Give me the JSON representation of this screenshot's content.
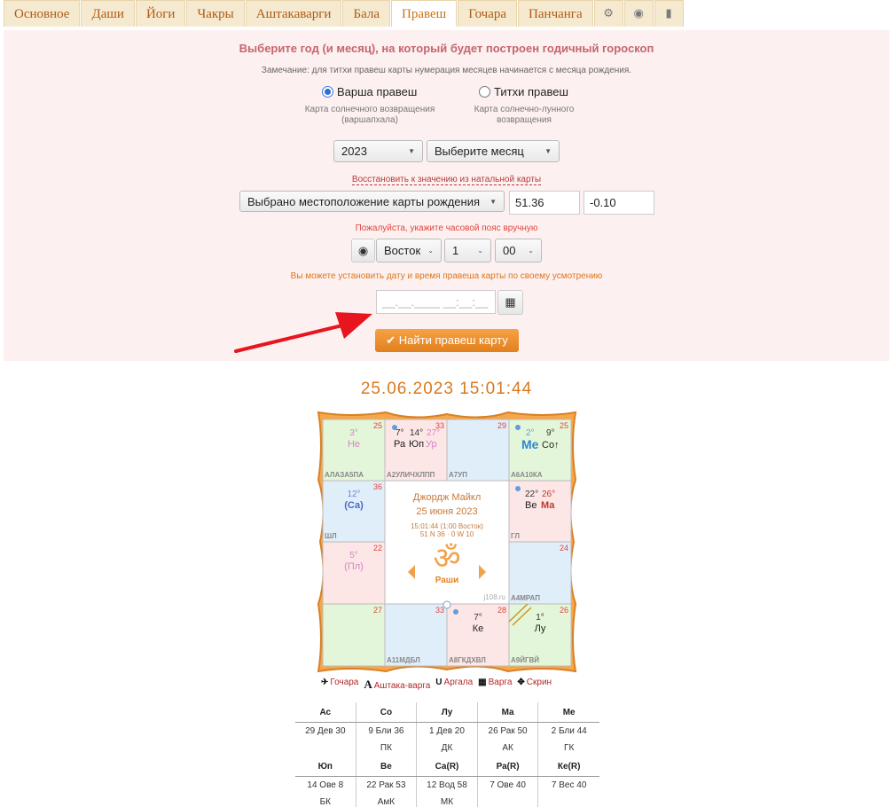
{
  "tabs": [
    "Основное",
    "Даши",
    "Йоги",
    "Чакры",
    "Аштакаварги",
    "Бала",
    "Правеш",
    "Гочара",
    "Панчанга"
  ],
  "active_tab": "Правеш",
  "icon_tabs": [
    "gear-icon",
    "globe-icon",
    "book-icon"
  ],
  "form": {
    "title": "Выберите год (и месяц), на который будет построен годичный гороскоп",
    "note": "Замечание: для титхи правеш карты нумерация месяцев начинается с месяца рождения.",
    "radio1_label": "Варша правеш",
    "radio1_sub1": "Карта солнечного возвращения",
    "radio1_sub2": "(варшапхала)",
    "radio2_label": "Титхи правеш",
    "radio2_sub1": "Карта солнечно-лунного",
    "radio2_sub2": "возвращения",
    "year": "2023",
    "month": "Выберите месяц",
    "restore_link": "Восстановить к значению из натальной карты",
    "location": "Выбрано местоположение карты рождения",
    "lat": "51.36",
    "lon": "-0.10",
    "tz_warning": "Пожалуйста, укажите часовой пояс вручную",
    "tz_dir": "Восток",
    "tz_hours": "1",
    "tz_minutes": "00",
    "datetime_info": "Вы можете установить дату и время правеша карты по своему усмотрению",
    "datetime_placeholder": "__.__.____ __:__:__",
    "submit": "Найти правеш карту"
  },
  "chart": {
    "date": "25.06.2023 15:01:44",
    "center_name": "Джордж Майкл",
    "center_date": "25 июня 2023",
    "center_time": "15:01:44 (1:00 Восток)",
    "center_coords": "51 N 36 · 0 W 10",
    "center_label": "Раши",
    "watermark": "j108.ru",
    "houses": {
      "h1": {
        "num": "25",
        "deg": "3°",
        "planet": "Не",
        "label": "АЛАЗА5ПА"
      },
      "h2": {
        "num": "33",
        "d1": "7°",
        "d2": "14°",
        "d3": "27°",
        "p1": "Ра",
        "p2": "Юп",
        "p3": "Ур",
        "label": "А2УЛИЧХЛПП"
      },
      "h3": {
        "num": "29",
        "label": "А7УП"
      },
      "h4": {
        "num": "25",
        "d1": "2°",
        "d2": "9°",
        "p1": "Ме",
        "p2": "Со↑",
        "label": "А6А10КА"
      },
      "h5": {
        "num": "36",
        "deg": "12°",
        "planet": "(Са)",
        "label": "ШЛ"
      },
      "h6": {
        "num": "",
        "d1": "22°",
        "d2": "26°",
        "p1": "Ве",
        "p2": "Ма",
        "label": "ГЛ"
      },
      "h7": {
        "num": "22",
        "deg": "5°",
        "planet": "(Пл)"
      },
      "h8": {
        "num": "24",
        "label": "А4МРАП"
      },
      "h9": {
        "num": "27"
      },
      "h10": {
        "num": "33",
        "label": "А11МДБЛ"
      },
      "h11": {
        "num": "28",
        "deg": "7°",
        "planet": "Ке",
        "label": "А8ГКДХВЛ"
      },
      "h12": {
        "num": "26",
        "deg": "1°",
        "planet": "Лу",
        "label": "А9ЙГВЙ"
      }
    }
  },
  "links": [
    "Гочара",
    "Аштака-варга",
    "Аргала",
    "Варга",
    "Скрин"
  ],
  "table": {
    "head1": [
      "Ас",
      "Со",
      "Лу",
      "Ма",
      "Ме"
    ],
    "val1": [
      "29 Дев 30",
      "9 Бли 36",
      "1 Дев 20",
      "26 Рак 50",
      "2 Бли 44"
    ],
    "sub1": [
      "",
      "ПК",
      "ДК",
      "АК",
      "ГК"
    ],
    "head2": [
      "Юп",
      "Ве",
      "Са(R)",
      "Ра(R)",
      "Ке(R)"
    ],
    "val2": [
      "14 Ове 8",
      "22 Рак 53",
      "12 Вод 58",
      "7 Ове 40",
      "7 Вес 40"
    ],
    "sub2": [
      "БК",
      "АмК",
      "МК",
      "",
      ""
    ]
  },
  "colors": {
    "accent": "#d9781e",
    "tab_bg": "#f5e9cf",
    "panel_bg": "#fdf0f0",
    "arrow": "#e8141e"
  }
}
